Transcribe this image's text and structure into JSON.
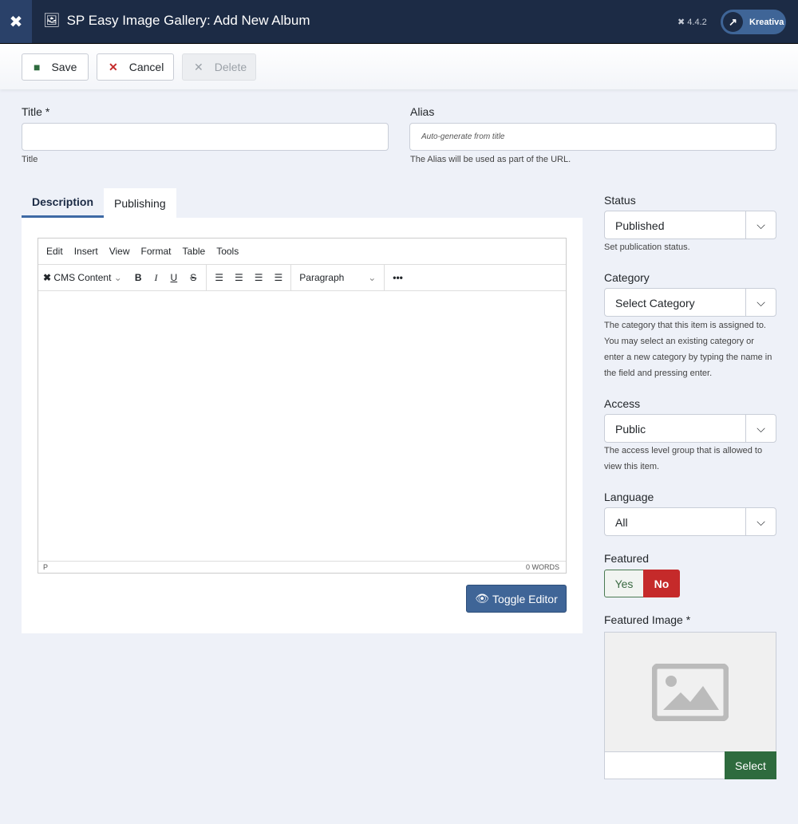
{
  "header": {
    "title": "SP Easy Image Gallery: Add New Album",
    "version": "4.4.2",
    "user": "Kreativa"
  },
  "toolbar": {
    "save": "Save",
    "cancel": "Cancel",
    "delete": "Delete"
  },
  "form": {
    "title_label": "Title *",
    "title_value": "",
    "title_help": "Title",
    "alias_label": "Alias",
    "alias_placeholder": "Auto-generate from title",
    "alias_help": "The Alias will be used as part of the URL."
  },
  "tabs": [
    "Description",
    "Publishing"
  ],
  "editor": {
    "menu": [
      "Edit",
      "Insert",
      "View",
      "Format",
      "Table",
      "Tools"
    ],
    "cms_content": "CMS Content",
    "block_format": "Paragraph",
    "path": "P",
    "word_count": "0 WORDS",
    "toggle": "Toggle Editor"
  },
  "sidebar": {
    "status": {
      "label": "Status",
      "value": "Published",
      "help": "Set publication status."
    },
    "category": {
      "label": "Category",
      "value": "Select Category",
      "help": "The category that this item is assigned to. You may select an existing category or enter a new category by typing the name in the field and pressing enter."
    },
    "access": {
      "label": "Access",
      "value": "Public",
      "help": "The access level group that is allowed to view this item."
    },
    "language": {
      "label": "Language",
      "value": "All"
    },
    "featured": {
      "label": "Featured",
      "yes": "Yes",
      "no": "No",
      "selected": "No"
    },
    "featured_image": {
      "label": "Featured Image *",
      "select": "Select"
    }
  }
}
